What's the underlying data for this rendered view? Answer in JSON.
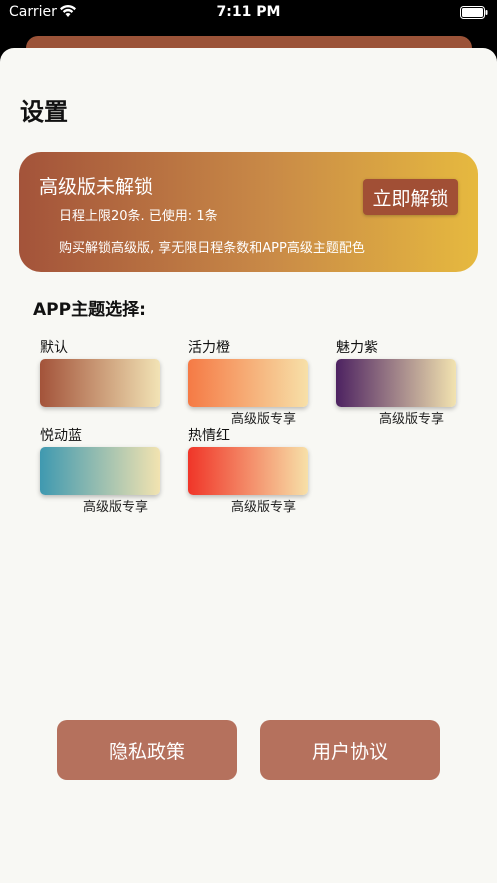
{
  "status_bar": {
    "carrier": "Carrier",
    "time": "7:11 PM"
  },
  "page": {
    "title": "设置"
  },
  "premium": {
    "title": "高级版未解锁",
    "limit_text": "日程上限20条. 已使用: 1条",
    "description": "购买解锁高级版, 享无限日程条数和APP高级主题配色",
    "unlock_label": "立即解锁"
  },
  "themes": {
    "heading": "APP主题选择:",
    "badge_label": "高级版专享",
    "items": [
      {
        "name": "默认",
        "premium": false,
        "gradient": [
          "#a3533a",
          "#f2e3b5"
        ]
      },
      {
        "name": "活力橙",
        "premium": true,
        "gradient": [
          "#f57a45",
          "#f7e0a8"
        ]
      },
      {
        "name": "魅力紫",
        "premium": true,
        "gradient": [
          "#4d2261",
          "#f2e3b0"
        ]
      },
      {
        "name": "悦动蓝",
        "premium": true,
        "gradient": [
          "#3f99b0",
          "#f2e3b0"
        ]
      },
      {
        "name": "热情红",
        "premium": true,
        "gradient": [
          "#f03528",
          "#f7e0a8"
        ]
      }
    ]
  },
  "footer": {
    "privacy_label": "隐私政策",
    "agreement_label": "用户协议"
  },
  "colors": {
    "accent": "#b5715d",
    "unlock_button": "#a14f35",
    "sheet_background": "#f8f8f4"
  }
}
